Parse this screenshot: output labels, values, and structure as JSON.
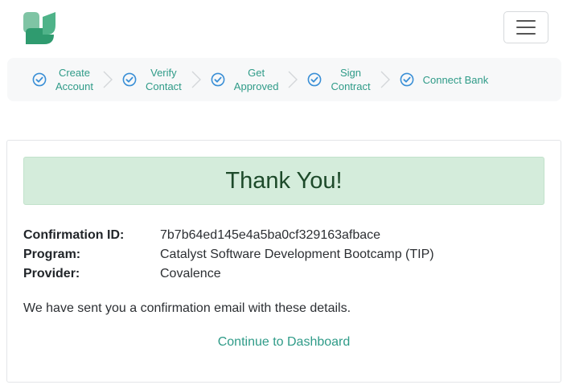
{
  "header": {
    "logo_icon": "app-logo-icon",
    "menu_icon": "hamburger-menu-icon"
  },
  "steps": [
    {
      "line1": "Create",
      "line2": "Account"
    },
    {
      "line1": "Verify",
      "line2": "Contact"
    },
    {
      "line1": "Get",
      "line2": "Approved"
    },
    {
      "line1": "Sign",
      "line2": "Contract"
    },
    {
      "line1": "Connect Bank",
      "line2": ""
    }
  ],
  "confirmation": {
    "title": "Thank You!",
    "fields": [
      {
        "label": "Confirmation ID:",
        "value": "7b7b64ed145e4a5ba0cf329163afbace"
      },
      {
        "label": "Program:",
        "value": "Catalyst Software Development Bootcamp (TIP)"
      },
      {
        "label": "Provider:",
        "value": "Covalence"
      }
    ],
    "note": "We have sent you a confirmation email with these details.",
    "cta_label": "Continue to Dashboard"
  },
  "colors": {
    "accent": "#2f9b88",
    "step_check": "#3a8fd6",
    "banner_bg": "#d4ecdb",
    "banner_text": "#1d4a2a"
  }
}
